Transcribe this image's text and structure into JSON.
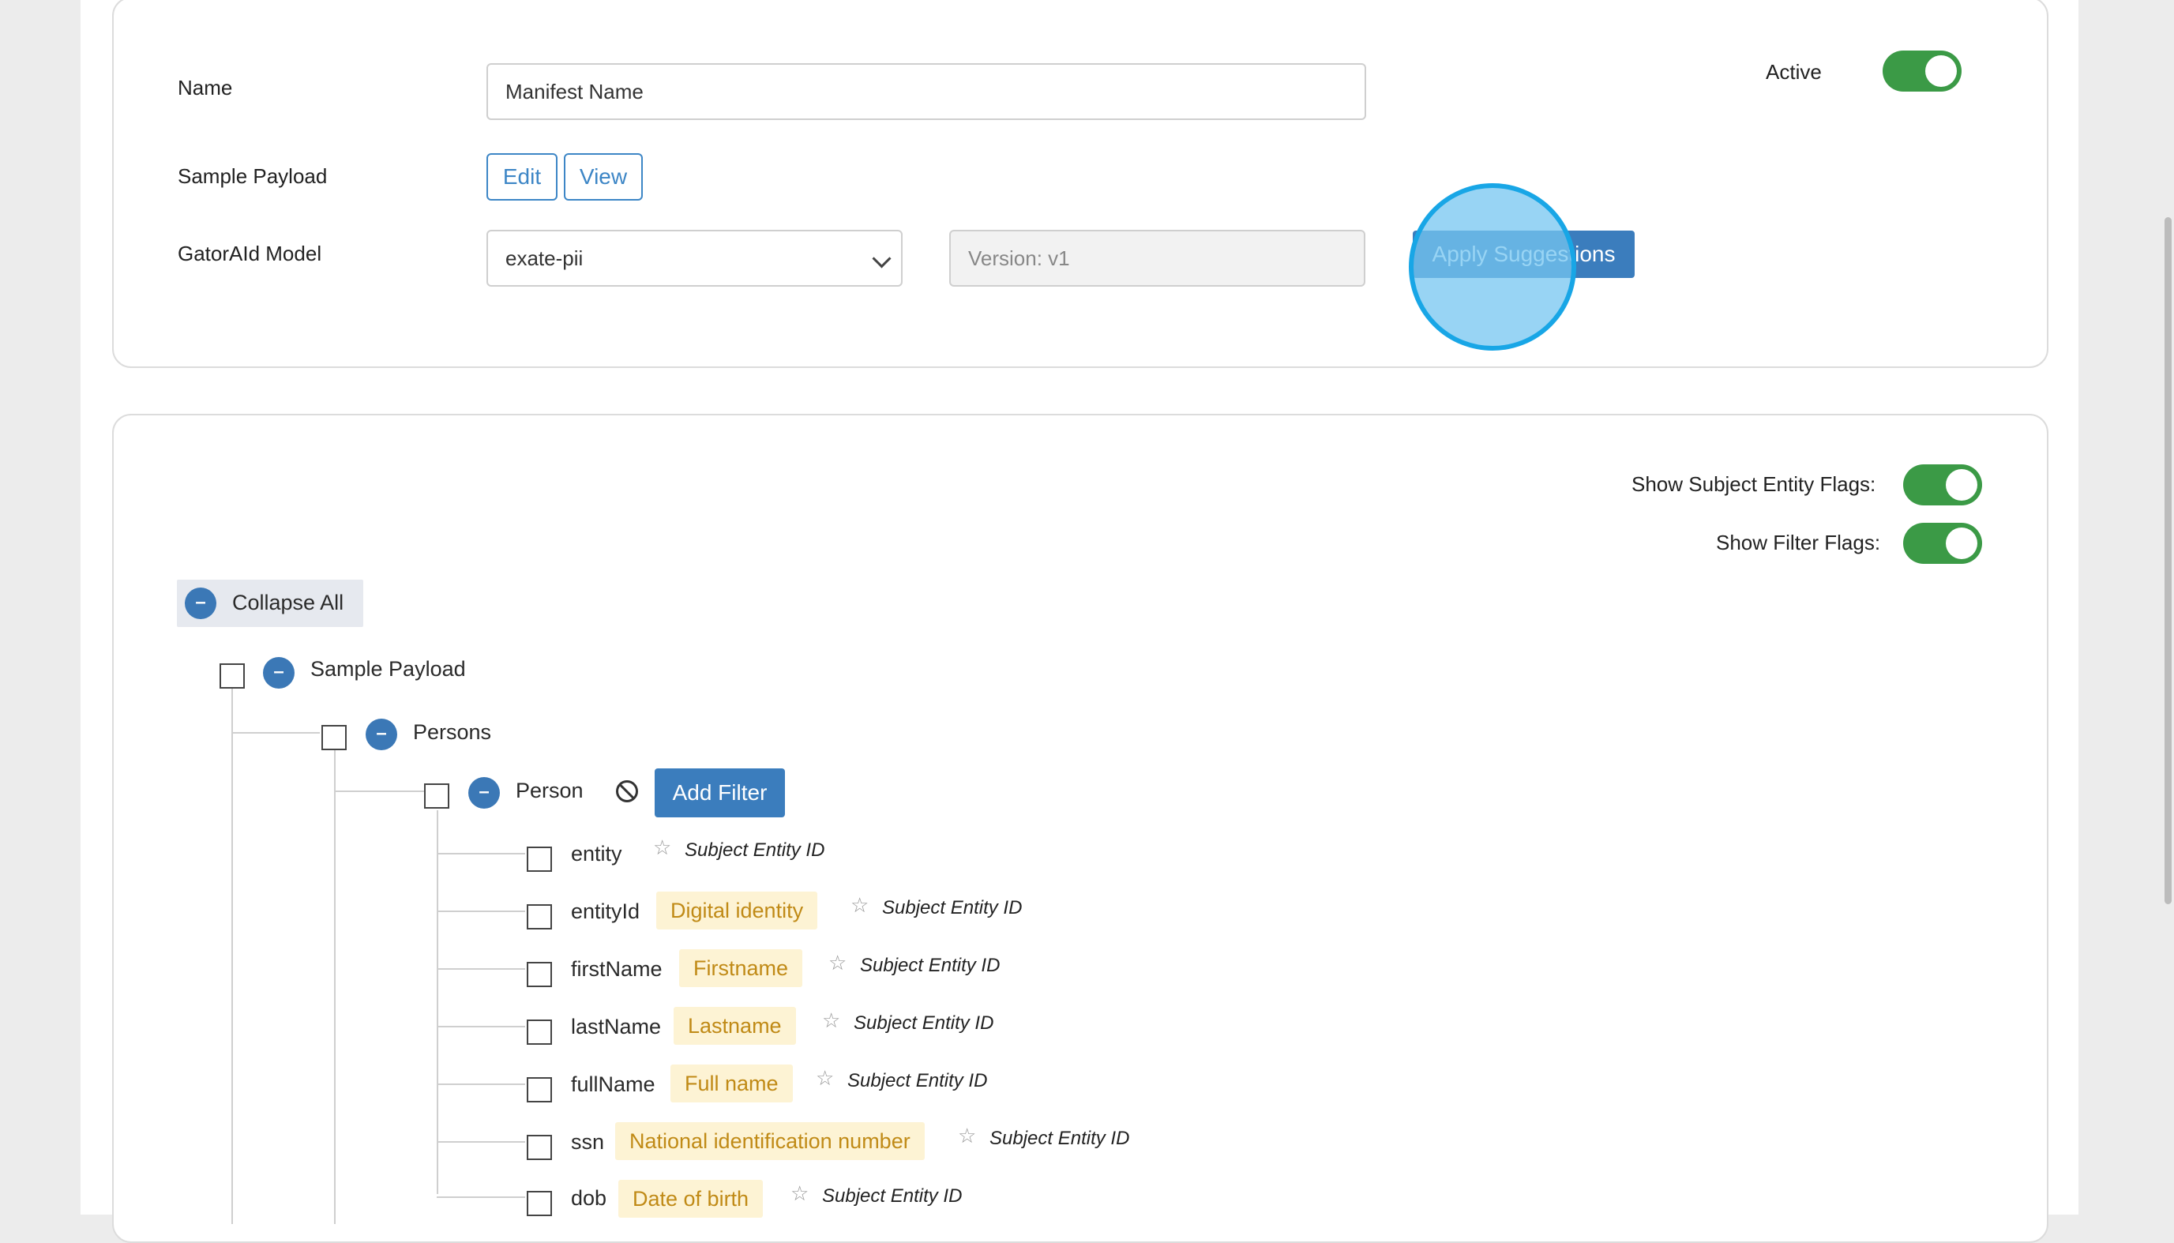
{
  "form": {
    "name_label": "Name",
    "name_value": "Manifest Name",
    "active_label": "Active",
    "sample_payload_label": "Sample Payload",
    "edit_label": "Edit",
    "view_label": "View",
    "model_label": "GatorAId Model",
    "model_selected": "exate-pii",
    "version_placeholder": "Version: v1",
    "apply_label": "Apply Suggestions"
  },
  "flags": {
    "show_subject_label": "Show Subject Entity Flags:",
    "show_filter_label": "Show Filter Flags:"
  },
  "tree": {
    "collapse_all": "Collapse All",
    "root": "Sample Payload",
    "persons": "Persons",
    "person": "Person",
    "add_filter": "Add Filter",
    "fields": [
      {
        "name": "entity",
        "tag": "",
        "flag": "Subject Entity ID"
      },
      {
        "name": "entityId",
        "tag": "Digital identity",
        "flag": "Subject Entity ID"
      },
      {
        "name": "firstName",
        "tag": "Firstname",
        "flag": "Subject Entity ID"
      },
      {
        "name": "lastName",
        "tag": "Lastname",
        "flag": "Subject Entity ID"
      },
      {
        "name": "fullName",
        "tag": "Full name",
        "flag": "Subject Entity ID"
      },
      {
        "name": "ssn",
        "tag": "National identification number",
        "flag": "Subject Entity ID"
      },
      {
        "name": "dob",
        "tag": "Date of birth",
        "flag": "Subject Entity ID"
      }
    ]
  },
  "colors": {
    "accent": "#3b7dbd",
    "toggle_on": "#3b9a46",
    "tag_bg": "#fdf3d4",
    "tag_text": "#c08a16"
  }
}
